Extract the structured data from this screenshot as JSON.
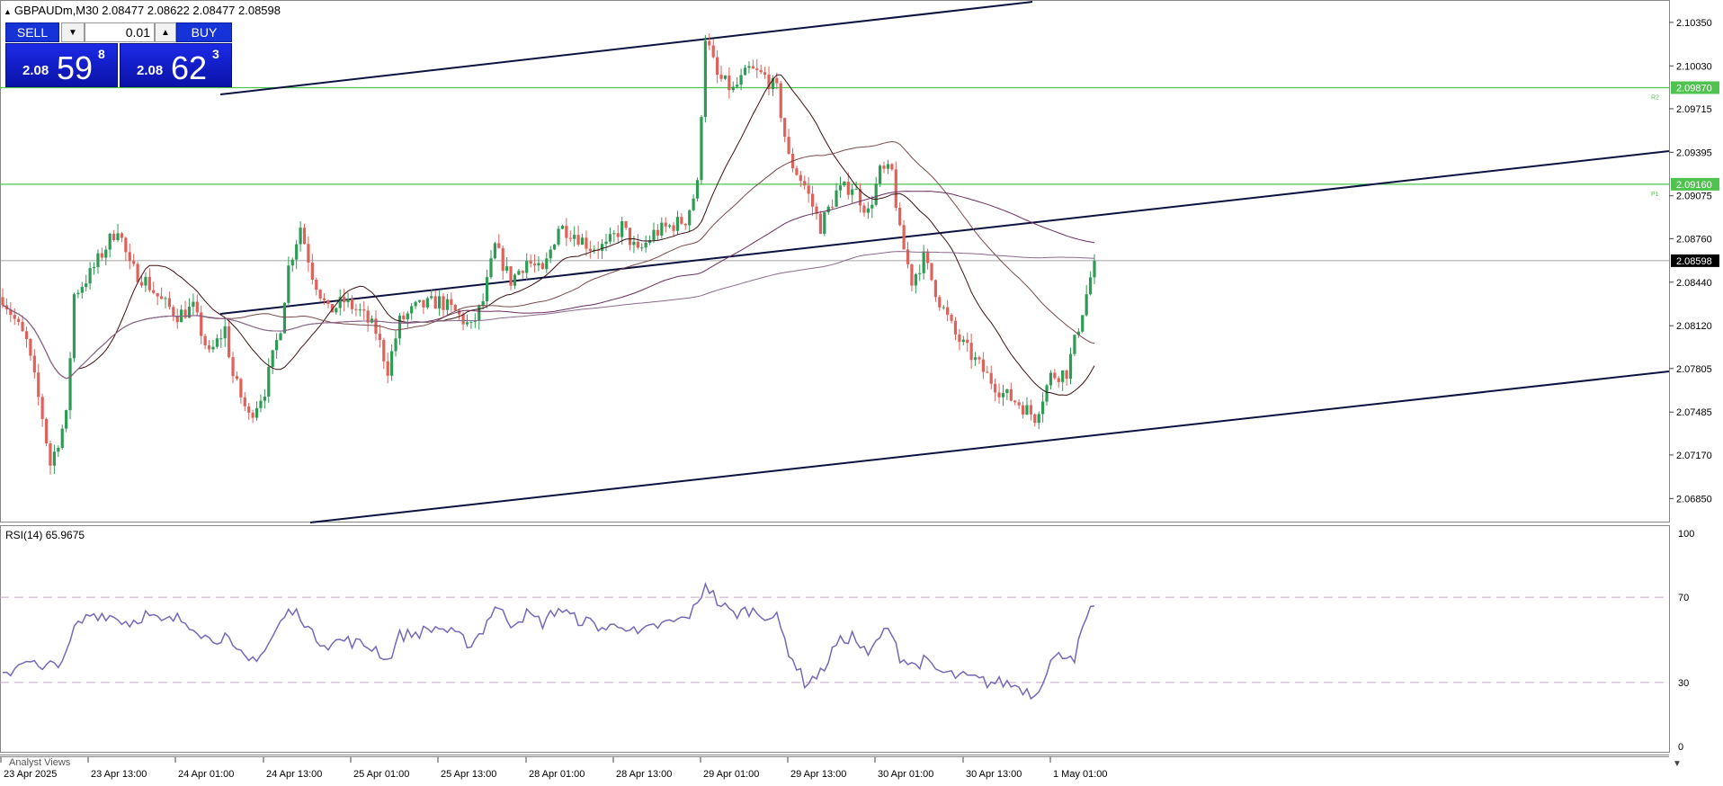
{
  "header": {
    "text": "GBPAUDm,M30  2.08477 2.08622 2.08477 2.08598"
  },
  "trade": {
    "sell_label": "SELL",
    "buy_label": "BUY",
    "lot": "0.01",
    "sell": {
      "prefix": "2.08",
      "big": "59",
      "sup": "8"
    },
    "buy": {
      "prefix": "2.08",
      "big": "62",
      "sup": "3"
    }
  },
  "price_axis": {
    "ticks": [
      "2.10350",
      "2.10030",
      "2.09715",
      "2.09395",
      "2.09075",
      "2.08760",
      "2.08440",
      "2.08120",
      "2.07805",
      "2.07485",
      "2.07170",
      "2.06850"
    ],
    "min": 2.0668,
    "max": 2.10488
  },
  "levels": [
    {
      "price": 2.0987,
      "label": "2.09870",
      "tag": "R2",
      "color": "#4ec44e"
    },
    {
      "price": 2.0916,
      "label": "2.09160",
      "tag": "P1",
      "color": "#4ec44e"
    }
  ],
  "current": {
    "price": 2.08598,
    "label": "2.08598"
  },
  "rsi": {
    "label": "RSI(14) 65.9675",
    "ticks": [
      "100",
      "70",
      "30",
      "0"
    ],
    "levels": [
      70,
      30
    ]
  },
  "time_axis": {
    "labels": [
      "23 Apr 2025",
      "23 Apr 13:00",
      "24 Apr 01:00",
      "24 Apr 13:00",
      "25 Apr 01:00",
      "25 Apr 13:00",
      "28 Apr 01:00",
      "28 Apr 13:00",
      "29 Apr 01:00",
      "29 Apr 13:00",
      "30 Apr 01:00",
      "30 Apr 13:00",
      "1 May 01:00"
    ]
  },
  "footer": {
    "analyst_views": "Analyst Views"
  },
  "colors": {
    "up": "#2e9b54",
    "down": "#e0605a",
    "ma": "#7a2d2d",
    "rsi": "#7866b8",
    "grid": "#c0c0c0"
  },
  "chart_data": {
    "type": "candlestick",
    "keypoints": [
      [
        0,
        2.0833
      ],
      [
        6,
        2.08
      ],
      [
        10,
        2.0745
      ],
      [
        12,
        2.071
      ],
      [
        16,
        2.0745
      ],
      [
        18,
        2.0835
      ],
      [
        22,
        2.085
      ],
      [
        26,
        2.087
      ],
      [
        29,
        2.0885
      ],
      [
        32,
        2.0855
      ],
      [
        36,
        2.0845
      ],
      [
        40,
        2.083
      ],
      [
        44,
        2.082
      ],
      [
        48,
        2.0825
      ],
      [
        52,
        2.079
      ],
      [
        56,
        2.081
      ],
      [
        58,
        2.0775
      ],
      [
        62,
        2.0745
      ],
      [
        66,
        2.0765
      ],
      [
        70,
        2.0812
      ],
      [
        72,
        2.0855
      ],
      [
        75,
        2.0885
      ],
      [
        78,
        2.085
      ],
      [
        82,
        2.0822
      ],
      [
        86,
        2.083
      ],
      [
        90,
        2.0822
      ],
      [
        94,
        2.0808
      ],
      [
        97,
        2.078
      ],
      [
        100,
        2.0815
      ],
      [
        104,
        2.0825
      ],
      [
        110,
        2.083
      ],
      [
        114,
        2.0822
      ],
      [
        118,
        2.081
      ],
      [
        121,
        2.083
      ],
      [
        124,
        2.087
      ],
      [
        128,
        2.0845
      ],
      [
        132,
        2.086
      ],
      [
        136,
        2.085
      ],
      [
        140,
        2.0885
      ],
      [
        144,
        2.088
      ],
      [
        148,
        2.087
      ],
      [
        152,
        2.087
      ],
      [
        156,
        2.0885
      ],
      [
        160,
        2.0865
      ],
      [
        164,
        2.088
      ],
      [
        168,
        2.0885
      ],
      [
        172,
        2.089
      ],
      [
        175,
        2.0915
      ],
      [
        177,
        2.1025
      ],
      [
        180,
        2.0995
      ],
      [
        184,
        2.0985
      ],
      [
        188,
        2.1
      ],
      [
        192,
        2.0995
      ],
      [
        195,
        2.0985
      ],
      [
        198,
        2.0935
      ],
      [
        202,
        2.0915
      ],
      [
        206,
        2.0885
      ],
      [
        210,
        2.091
      ],
      [
        214,
        2.0915
      ],
      [
        218,
        2.0895
      ],
      [
        221,
        2.0925
      ],
      [
        224,
        2.0925
      ],
      [
        226,
        2.088
      ],
      [
        229,
        2.0845
      ],
      [
        232,
        2.0862
      ],
      [
        236,
        2.083
      ],
      [
        240,
        2.0805
      ],
      [
        244,
        2.079
      ],
      [
        248,
        2.0775
      ],
      [
        252,
        2.0762
      ],
      [
        256,
        2.0755
      ],
      [
        260,
        2.0745
      ],
      [
        264,
        2.0775
      ],
      [
        268,
        2.0778
      ],
      [
        270,
        2.08
      ],
      [
        273,
        2.0835
      ],
      [
        275,
        2.08598
      ]
    ],
    "rsi_keypoints": [
      [
        0,
        32
      ],
      [
        6,
        42
      ],
      [
        10,
        35
      ],
      [
        12,
        38
      ],
      [
        16,
        42
      ],
      [
        18,
        55
      ],
      [
        22,
        62
      ],
      [
        26,
        62
      ],
      [
        29,
        60
      ],
      [
        32,
        58
      ],
      [
        36,
        62
      ],
      [
        40,
        58
      ],
      [
        44,
        60
      ],
      [
        48,
        57
      ],
      [
        52,
        50
      ],
      [
        56,
        52
      ],
      [
        58,
        45
      ],
      [
        62,
        40
      ],
      [
        66,
        45
      ],
      [
        70,
        58
      ],
      [
        72,
        63
      ],
      [
        75,
        62
      ],
      [
        78,
        52
      ],
      [
        82,
        48
      ],
      [
        86,
        50
      ],
      [
        90,
        48
      ],
      [
        94,
        46
      ],
      [
        97,
        40
      ],
      [
        100,
        52
      ],
      [
        104,
        53
      ],
      [
        110,
        56
      ],
      [
        114,
        52
      ],
      [
        118,
        48
      ],
      [
        121,
        55
      ],
      [
        124,
        66
      ],
      [
        128,
        58
      ],
      [
        132,
        62
      ],
      [
        136,
        58
      ],
      [
        140,
        65
      ],
      [
        144,
        60
      ],
      [
        148,
        58
      ],
      [
        152,
        55
      ],
      [
        156,
        58
      ],
      [
        160,
        52
      ],
      [
        164,
        56
      ],
      [
        168,
        58
      ],
      [
        172,
        60
      ],
      [
        175,
        66
      ],
      [
        177,
        77
      ],
      [
        180,
        68
      ],
      [
        184,
        62
      ],
      [
        188,
        64
      ],
      [
        192,
        62
      ],
      [
        195,
        60
      ],
      [
        198,
        45
      ],
      [
        202,
        30
      ],
      [
        206,
        34
      ],
      [
        210,
        48
      ],
      [
        214,
        52
      ],
      [
        218,
        42
      ],
      [
        221,
        52
      ],
      [
        224,
        55
      ],
      [
        226,
        42
      ],
      [
        229,
        38
      ],
      [
        232,
        40
      ],
      [
        236,
        35
      ],
      [
        240,
        33
      ],
      [
        244,
        32
      ],
      [
        248,
        30
      ],
      [
        252,
        30
      ],
      [
        256,
        28
      ],
      [
        260,
        24
      ],
      [
        264,
        40
      ],
      [
        268,
        44
      ],
      [
        270,
        42
      ],
      [
        273,
        60
      ],
      [
        275,
        66
      ]
    ]
  }
}
